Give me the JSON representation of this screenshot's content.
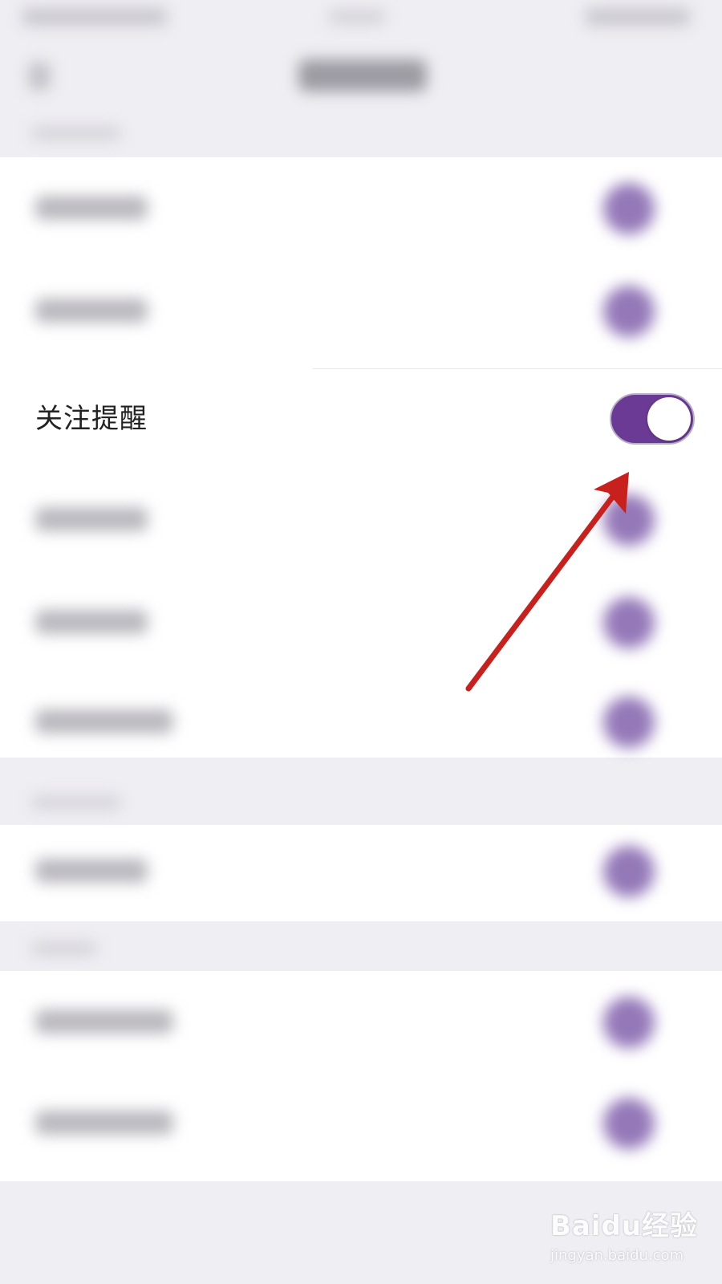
{
  "setting": {
    "label": "关注提醒",
    "toggle_on": true
  },
  "colors": {
    "toggle_track": "#6b3a94",
    "toggle_knob": "#ffffff",
    "arrow": "#c8201c",
    "blurred_knob": "#9478b8",
    "background": "#efeef3"
  },
  "watermark": {
    "logo": "Baidu经验",
    "url": "jingyan.baidu.com"
  }
}
